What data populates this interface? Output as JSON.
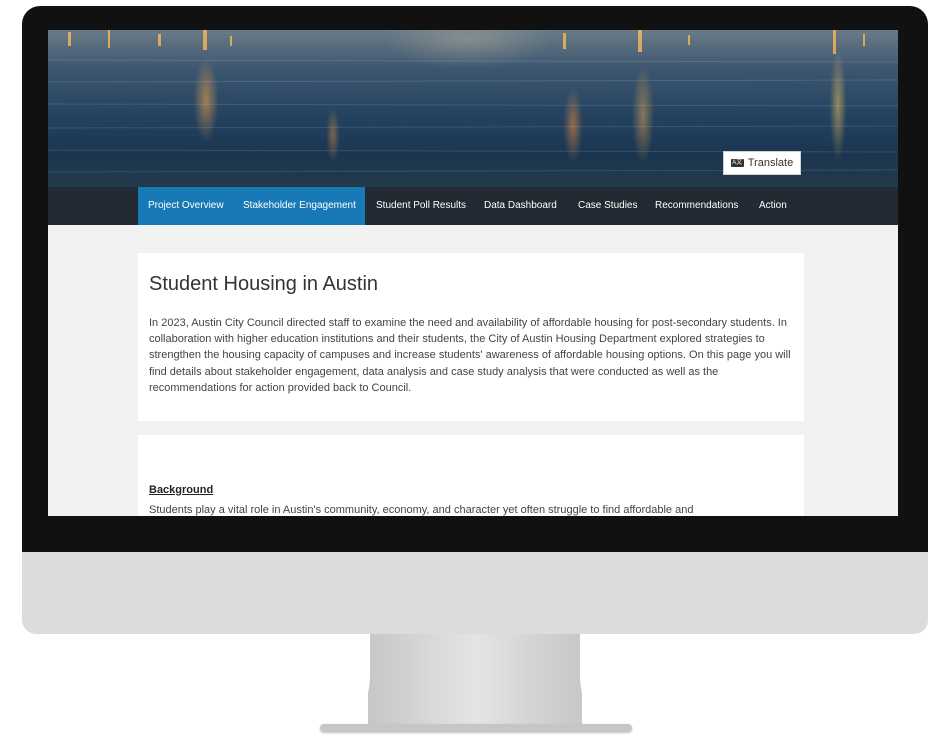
{
  "screen": {
    "translate": {
      "icon": "translate-icon",
      "label": "Translate"
    },
    "nav": {
      "items": [
        {
          "label": "Project Overview",
          "active": true
        },
        {
          "label": "Stakeholder Engagement",
          "active": true
        },
        {
          "label": "Student Poll Results",
          "active": false
        },
        {
          "label": "Data Dashboard",
          "active": false
        },
        {
          "label": "Case Studies",
          "active": false
        },
        {
          "label": "Recommendations",
          "active": false
        },
        {
          "label": "Action",
          "active": false
        }
      ]
    },
    "main": {
      "title": "Student Housing in Austin",
      "intro": "In 2023, Austin City Council directed staff to examine the need and availability of affordable housing for post-secondary students. In collaboration with higher education institutions and their students, the City of Austin Housing Department explored strategies to strengthen the housing capacity of campuses and increase students' awareness of affordable housing options. On this page you will find details about stakeholder engagement, data analysis and case study analysis that were conducted as well as the recommendations for action provided back to Council.",
      "background_heading": "Background",
      "background_text": "Students play a vital role in Austin's community, economy, and character yet often struggle to find affordable and"
    }
  },
  "colors": {
    "nav_bg": "#232a33",
    "nav_active": "#1779b5",
    "bezel": "#111111",
    "chin": "#dcdcdc"
  }
}
